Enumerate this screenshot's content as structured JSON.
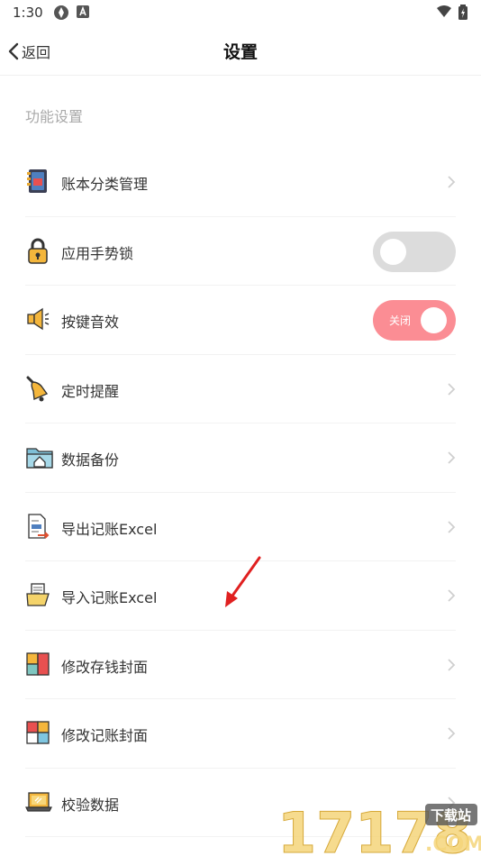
{
  "status": {
    "time": "1:30"
  },
  "header": {
    "back_label": "返回",
    "title": "设置"
  },
  "section": {
    "label": "功能设置"
  },
  "rows": [
    {
      "label": "账本分类管理",
      "icon": "ledger-book-icon"
    },
    {
      "label": "应用手势锁",
      "icon": "padlock-icon"
    },
    {
      "label": "按键音效",
      "icon": "speaker-icon",
      "toggle_text": "关闭"
    },
    {
      "label": "定时提醒",
      "icon": "bell-icon"
    },
    {
      "label": "数据备份",
      "icon": "folder-home-icon"
    },
    {
      "label": "导出记账Excel",
      "icon": "export-document-icon"
    },
    {
      "label": "导入记账Excel",
      "icon": "import-folder-icon"
    },
    {
      "label": "修改存钱封面",
      "icon": "cover-grid-icon"
    },
    {
      "label": "修改记账封面",
      "icon": "cover-grid-alt-icon"
    },
    {
      "label": "校验数据",
      "icon": "laptop-icon"
    }
  ],
  "watermark": {
    "number": "17178",
    "badge": "下载站",
    "domain": ".COM"
  },
  "colors": {
    "toggle_on": "#fb8d94",
    "toggle_off": "#dcdcdc",
    "section_label": "#a9a9a9",
    "annotation_arrow": "#e02020"
  }
}
